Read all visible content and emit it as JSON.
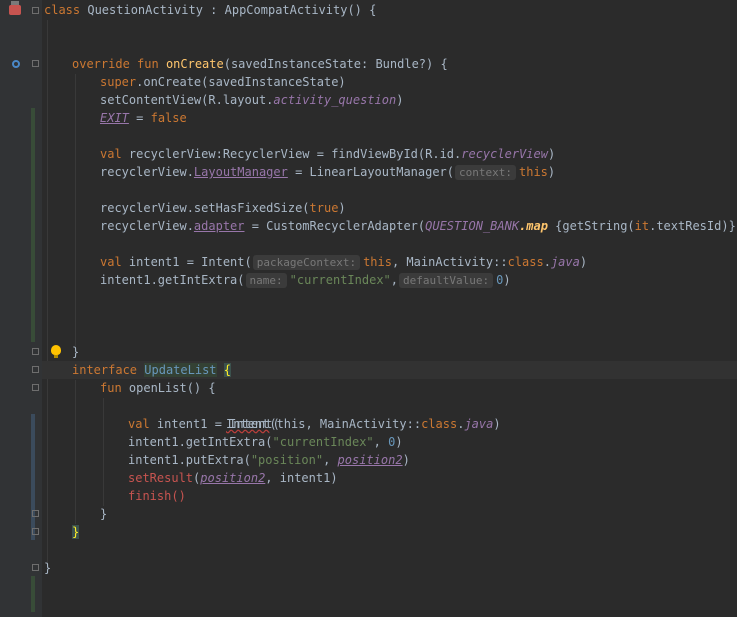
{
  "editor": {
    "lines": [
      {
        "t": "class QuestionActivity : AppCompatActivity() {"
      },
      {
        "t": ""
      },
      {
        "t": ""
      },
      {
        "t": "override fun onCreate(savedInstanceState: Bundle?) {"
      },
      {
        "t": "super.onCreate(savedInstanceState)"
      },
      {
        "t": "setContentView(R.layout.activity_question)"
      },
      {
        "t": "EXIT = false"
      },
      {
        "t": ""
      },
      {
        "t": "val recyclerView:RecyclerView = findViewById(R.id.recyclerView)"
      },
      {
        "t": "recyclerView.LayoutManager = LinearLayoutManager( context: this)"
      },
      {
        "t": ""
      },
      {
        "t": "recyclerView.setHasFixedSize(true)"
      },
      {
        "t": "recyclerView.adapter = CustomRecyclerAdapter(QUESTION_BANK.map {getString(it.textResId)})"
      },
      {
        "t": ""
      },
      {
        "t": "val intent1 = Intent( packageContext: this, MainActivity::class.java)"
      },
      {
        "t": "intent1.getIntExtra( name: \"currentIndex\",  defaultValue: 0)"
      }
    ],
    "tokens": {
      "class_kw": "class",
      "class_name": "QuestionActivity",
      "extends": " : AppCompatActivity() {",
      "override_kw": "override fun",
      "on_create": "onCreate",
      "on_create_args": "(savedInstanceState: Bundle?) {",
      "super_kw": "super",
      "super_rest": ".onCreate(savedInstanceState)",
      "set_content": "setContentView(R.layout.",
      "activity_question": "activity_question",
      "close_paren": ")",
      "exit": "EXIT",
      "eq": " = ",
      "false_kw": "false",
      "val_kw": "val",
      "rv_decl": " recyclerView:RecyclerView = findViewById(R.id.",
      "recycler_view": "recyclerView",
      "rv_prefix": "recyclerView.",
      "layout_manager": "LayoutManager",
      "llm": " = LinearLayoutManager(",
      "hint_context": "context:",
      "this_kw": "this",
      "fixed_size": "recyclerView.setHasFixedSize(",
      "true_kw": "true",
      "adapter": "adapter",
      "custom_adapter": " = CustomRecyclerAdapter(",
      "question_bank": "QUESTION_BANK",
      "map": ".map",
      "get_string": " {getString(",
      "it_kw": "it",
      "text_res": ".textResId)})",
      "intent_decl": " intent1 = Intent(",
      "hint_package": "packageContext:",
      "main_activity": ", MainActivity::",
      "class_word": "class",
      "java": "java",
      "get_int_extra": "intent1.getIntExtra(",
      "hint_name": "name:",
      "current_index": "\"currentIndex\"",
      "comma": ",",
      "hint_default": "defaultValue:",
      "zero": "0",
      "close_brace": "}",
      "interface_kw": "interface",
      "update_list": "UpdateList",
      "open_brace": "{",
      "fun_kw": "fun",
      "open_list": " openList() {",
      "intent_plain": "Intent",
      "this_paren": "(this, MainActivity::",
      "put_extra": "intent1.putExtra(",
      "position_str": "\"position\"",
      "position2": "position2",
      "set_result": "setResult",
      "intent1_tail": ", intent1)",
      "finish": "finish()",
      "open_paren": "(",
      "comma_space": ", ",
      "dot": ".",
      "space": " ",
      "dot_java_close": ".java)"
    }
  },
  "colors": {
    "background": "#2b2b2b",
    "keyword": "#cc7832",
    "function": "#ffc66d",
    "string": "#6a8759",
    "number": "#6897bb",
    "property": "#9876aa"
  },
  "icons": [
    "run-config-icon",
    "override-icon",
    "intention-bulb-icon",
    "fold-icon"
  ]
}
